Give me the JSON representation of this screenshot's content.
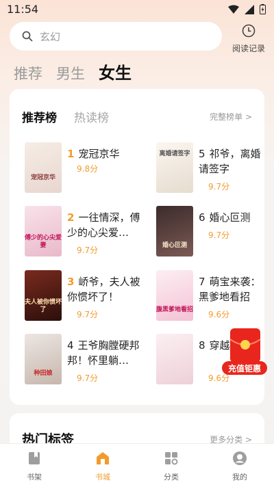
{
  "status_bar": {
    "time": "11:54"
  },
  "search": {
    "placeholder": "玄幻",
    "history_label": "阅读记录"
  },
  "category_tabs": [
    "推荐",
    "男生",
    "女生"
  ],
  "ranking": {
    "tabs": [
      "推荐榜",
      "热读榜"
    ],
    "full_link": "完整榜单 >",
    "books": [
      {
        "rank": "1",
        "title": "宠冠京华",
        "score": "9.8分",
        "cover_text": "宠冠京华"
      },
      {
        "rank": "2",
        "title": "一往情深，傅少的心尖爱…",
        "score": "9.7分",
        "cover_text": "傅少的心尖爱妻"
      },
      {
        "rank": "3",
        "title": "峤爷，夫人被你惯坏了！",
        "score": "9.7分",
        "cover_text": "夫人被你惯坏了"
      },
      {
        "rank": "4",
        "title": "王爷胸膛硬邦邦！怀里躺…",
        "score": "9.7分",
        "cover_text": "种田娘"
      },
      {
        "rank": "5",
        "title": "祁爷，离婚请签字",
        "score": "9.7分",
        "cover_text": "离婚请签字"
      },
      {
        "rank": "6",
        "title": "婚心叵测",
        "score": "9.7分",
        "cover_text": "婚心叵测"
      },
      {
        "rank": "7",
        "title": "萌宝来袭：黑爹地看招",
        "score": "9.6分",
        "cover_text": "腹黑爹地看招"
      },
      {
        "rank": "8",
        "title": "穿越患子",
        "score": "9.6分",
        "cover_text": ""
      }
    ]
  },
  "promo": {
    "label": "充值钜惠"
  },
  "hot_tags": {
    "title": "热门标签",
    "more": "更多分类 >"
  },
  "bottom_nav": [
    {
      "label": "书架",
      "icon": "bookshelf-icon",
      "active": false
    },
    {
      "label": "书城",
      "icon": "store-icon",
      "active": true
    },
    {
      "label": "分类",
      "icon": "category-icon",
      "active": false
    },
    {
      "label": "我的",
      "icon": "profile-icon",
      "active": false
    }
  ],
  "colors": {
    "accent": "#f29b2c",
    "promo_red": "#e8261e"
  }
}
